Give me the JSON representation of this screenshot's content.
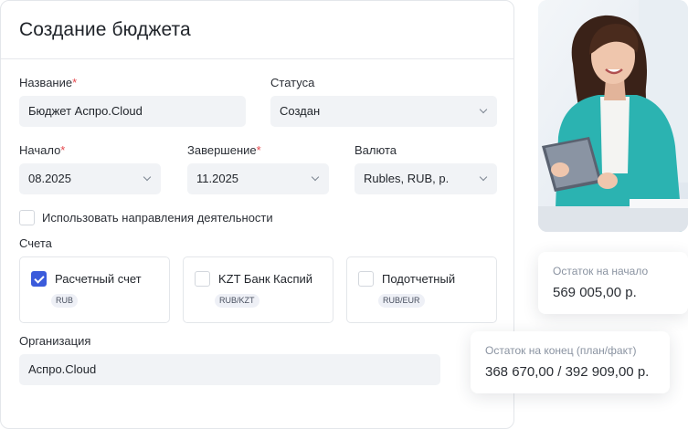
{
  "form": {
    "title": "Создание бюджета",
    "name": {
      "label": "Название",
      "required_mark": "*",
      "value": "Бюджет Аспро.Cloud"
    },
    "status": {
      "label": "Статуса",
      "value": "Создан"
    },
    "start": {
      "label": "Начало",
      "required_mark": "*",
      "value": "08.2025"
    },
    "end": {
      "label": "Завершение",
      "required_mark": "*",
      "value": "11.2025"
    },
    "currency": {
      "label": "Валюта",
      "value": "Rubles, RUB, р."
    },
    "use_directions": {
      "label": "Использовать направления деятельности",
      "checked": false
    },
    "accounts": {
      "label": "Счета",
      "items": [
        {
          "name": "Расчетный счет",
          "badge": "RUB",
          "checked": true
        },
        {
          "name": "KZT Банк Каспий",
          "badge": "RUB/KZT",
          "checked": false
        },
        {
          "name": "Подотчетный",
          "badge": "RUB/EUR",
          "checked": false
        }
      ]
    },
    "organization": {
      "label": "Организация",
      "value": "Аспро.Cloud"
    }
  },
  "cards": {
    "start_balance": {
      "label": "Остаток на начало",
      "value": "569 005,00 р."
    },
    "end_balance": {
      "label": "Остаток на конец (план/факт)",
      "value": "368 670,00 / 392 909,00 р."
    }
  },
  "colors": {
    "accent": "#3b5bdb",
    "required": "#e5484d",
    "jacket": "#2bb3b1"
  },
  "icons": {
    "select": "chevron-down-icon",
    "check": "checkmark-icon"
  }
}
